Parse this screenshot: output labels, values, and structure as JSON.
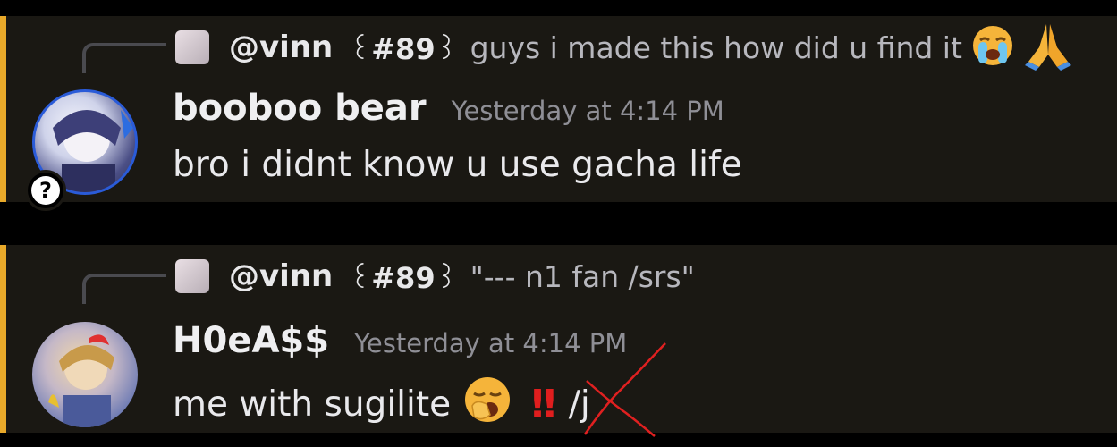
{
  "messages": [
    {
      "reply": {
        "mention": "@vinn",
        "tag_prefix": "꒰",
        "tag_num": "#89",
        "tag_suffix": "꒱",
        "text": "guys i made this how did u find it",
        "emojis": [
          "crying-face",
          "folded-hands"
        ]
      },
      "author": "booboo bear",
      "timestamp": "Yesterday at 4:14 PM",
      "content": "bro i didnt know u use gacha life",
      "badge": "?"
    },
    {
      "reply": {
        "mention": "@vinn",
        "tag_prefix": "꒰",
        "tag_num": "#89",
        "tag_suffix": "꒱",
        "text": "\"--- n1 fan /srs\"",
        "emojis": []
      },
      "author": "H0eA$$",
      "timestamp": "Yesterday at 4:14 PM",
      "content": "me with sugilite",
      "bang": "‼",
      "struck_text": "/j"
    }
  ],
  "colors": {
    "accent": "#e8a92a",
    "background": "#1a1813",
    "scribble": "#e02020"
  }
}
